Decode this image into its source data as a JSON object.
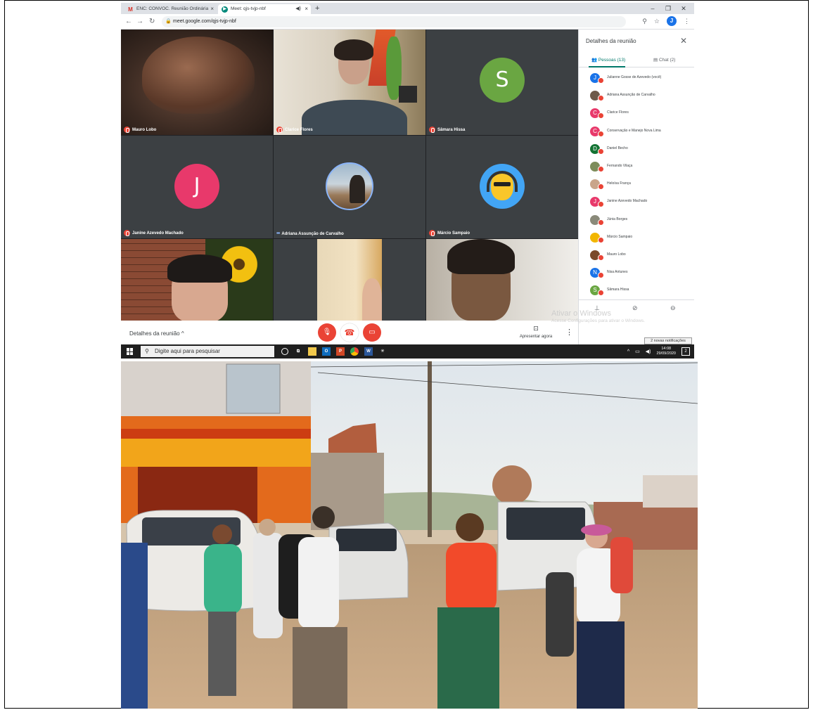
{
  "browser": {
    "tabs": [
      {
        "label": "ENC: CONVOC. Reunião Ordinária",
        "favicon": "M"
      },
      {
        "label": "Meet: qjs-tvjp-nbf",
        "favicon": "meet"
      }
    ],
    "url": "meet.google.com/qjs-tvjp-nbf",
    "profile_initial": "J"
  },
  "meeting": {
    "tiles": [
      {
        "name": "Mauro Lobo",
        "state": "muted"
      },
      {
        "name": "Clarice Flores",
        "state": "muted"
      },
      {
        "name": "Sâmara Hissa",
        "state": "muted",
        "initial": "S",
        "color": "#6aa642"
      },
      {
        "name": "Janine Azevedo Machado",
        "state": "muted",
        "initial": "J",
        "color": "#e8396b"
      },
      {
        "name": "Adriana Assunção de Carvalho",
        "state": "speaking"
      },
      {
        "name": "Márcio Sampaio",
        "state": "muted"
      }
    ],
    "details_label": "Detalhes da reunião",
    "present_label": "Apresentar agora"
  },
  "sidebar": {
    "title": "Detalhes da reunião",
    "tab_people": "Pessoas (13)",
    "tab_chat": "Chat (2)",
    "people": [
      {
        "name": "Julianne Gosse de Azevedo (você)",
        "initial": "J",
        "color": "#1a73e8"
      },
      {
        "name": "Adriana Assunção de Carvalho",
        "initial": "",
        "color": "#6d5a4a"
      },
      {
        "name": "Clarice Flores",
        "initial": "C",
        "color": "#e8396b"
      },
      {
        "name": "Conservação e Manejo Nova Lima",
        "initial": "C",
        "color": "#e8396b"
      },
      {
        "name": "Daniel Becho",
        "initial": "D",
        "color": "#137333"
      },
      {
        "name": "Fernando Vilaça",
        "initial": "",
        "color": "#7d8c5a"
      },
      {
        "name": "Heloísa França",
        "initial": "",
        "color": "#c9a58a"
      },
      {
        "name": "Janine Azevedo Machado",
        "initial": "J",
        "color": "#e8396b"
      },
      {
        "name": "Júnia Borges",
        "initial": "",
        "color": "#8a8a7a"
      },
      {
        "name": "Márcio Sampaio",
        "initial": "",
        "color": "#f2b600"
      },
      {
        "name": "Mauro Lobo",
        "initial": "",
        "color": "#7a4a2a"
      },
      {
        "name": "Nisa Antunes",
        "initial": "N",
        "color": "#1a73e8"
      },
      {
        "name": "Sâmara Hissa",
        "initial": "S",
        "color": "#6aa642"
      }
    ]
  },
  "windows": {
    "watermark_title": "Ativar o Windows",
    "watermark_sub": "Acesse Configurações para ativar o Windows.",
    "notification": "2 novas notificações",
    "search_placeholder": "Digite aqui para pesquisar",
    "time": "14:08",
    "date": "29/09/2020"
  }
}
